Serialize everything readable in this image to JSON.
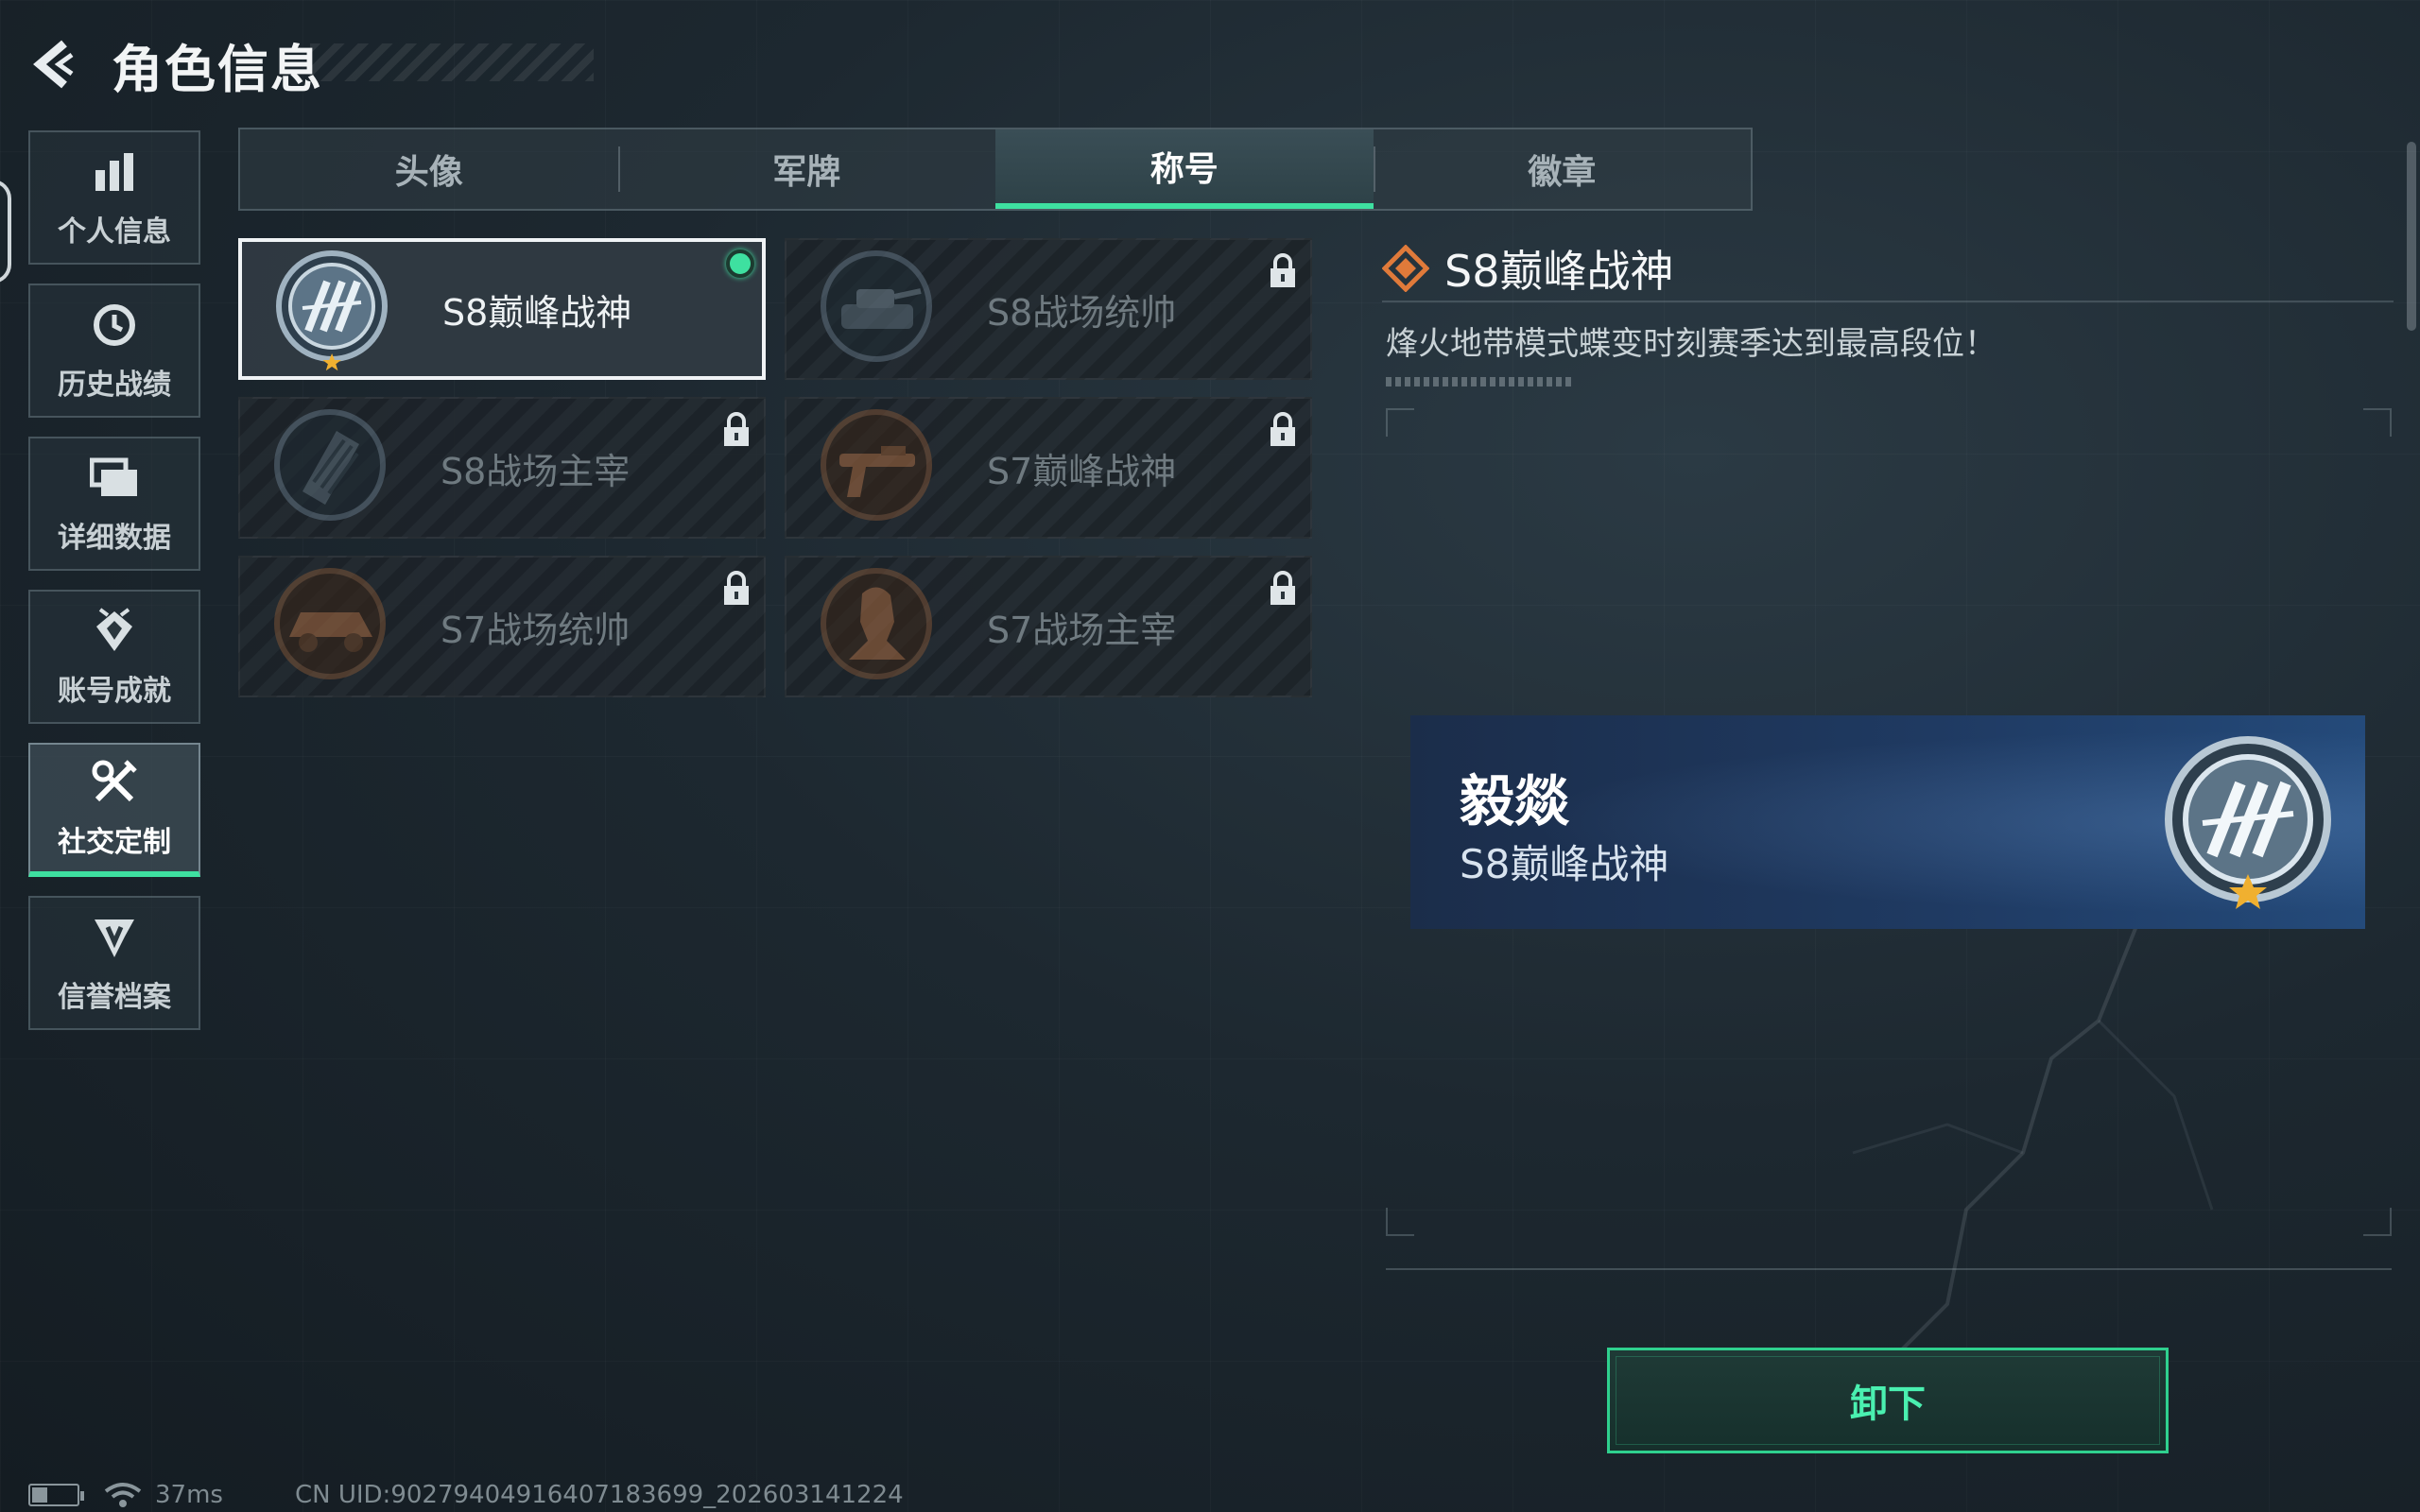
{
  "header": {
    "title": "角色信息"
  },
  "sidebar": {
    "items": [
      {
        "label": "个人信息",
        "icon": "bar-chart-icon"
      },
      {
        "label": "历史战绩",
        "icon": "history-clock-icon"
      },
      {
        "label": "详细数据",
        "icon": "folder-icon"
      },
      {
        "label": "账号成就",
        "icon": "achievement-icon"
      },
      {
        "label": "社交定制",
        "icon": "tools-icon",
        "active": true
      },
      {
        "label": "信誉档案",
        "icon": "shield-credit-icon"
      }
    ]
  },
  "tabs": [
    {
      "label": "头像"
    },
    {
      "label": "军牌"
    },
    {
      "label": "称号",
      "active": true
    },
    {
      "label": "徽章"
    }
  ],
  "titles": [
    {
      "name": "S8巅峰战神",
      "locked": false,
      "equipped": true,
      "emblem": "emblem-s8-peak"
    },
    {
      "name": "S8战场统帅",
      "locked": true,
      "emblem": "emblem-tank"
    },
    {
      "name": "S8战场主宰",
      "locked": true,
      "emblem": "emblem-rocket"
    },
    {
      "name": "S7巅峰战神",
      "locked": true,
      "emblem": "emblem-gun"
    },
    {
      "name": "S7战场统帅",
      "locked": true,
      "emblem": "emblem-vehicle"
    },
    {
      "name": "S7战场主宰",
      "locked": true,
      "emblem": "emblem-soldier"
    }
  ],
  "detail": {
    "title": "S8巅峰战神",
    "description": "烽火地带模式蝶变时刻赛季达到最高段位！"
  },
  "preview": {
    "player_name": "毅燚",
    "title": "S8巅峰战神"
  },
  "actions": {
    "unequip": "卸下"
  },
  "status": {
    "ping": "37ms",
    "uid": "CN UID:902794049164071836​99_202603141224"
  },
  "colors": {
    "accent": "#3ee0a0",
    "highlight": "#e07a3a"
  }
}
